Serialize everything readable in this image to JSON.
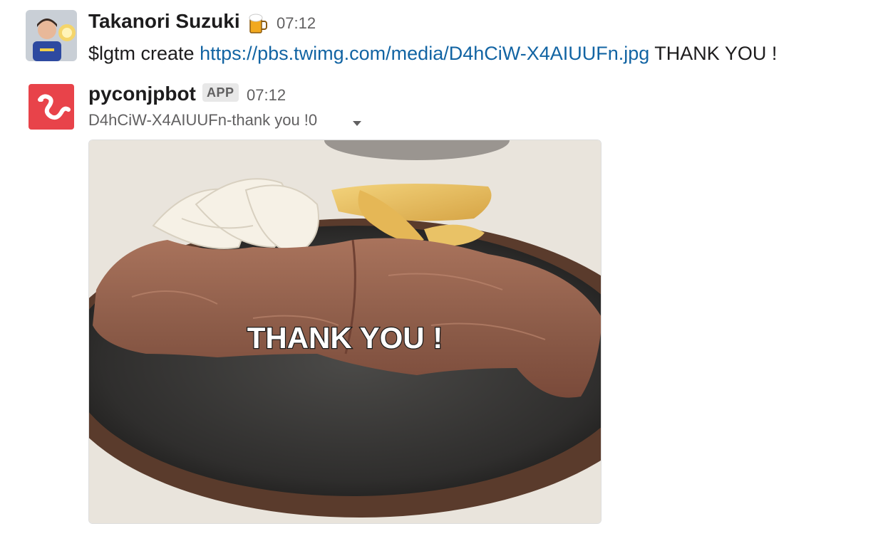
{
  "messages": [
    {
      "author": "Takanori Suzuki",
      "status_emoji": "beer-mug-icon",
      "time": "07:12",
      "text_prefix": "$lgtm create ",
      "link": "https://pbs.twimg.com/media/D4hCiW-X4AIUUFn.jpg",
      "text_suffix": " THANK YOU !"
    },
    {
      "author": "pyconjpbot",
      "badge": "APP",
      "time": "07:12",
      "attachment_title": "D4hCiW-X4AIUUFn-thank you !0",
      "image_overlay_text": "THANK YOU !"
    }
  ],
  "colors": {
    "link": "#1264a3",
    "bot_avatar_bg": "#e8434a",
    "muted_text": "#616061"
  }
}
